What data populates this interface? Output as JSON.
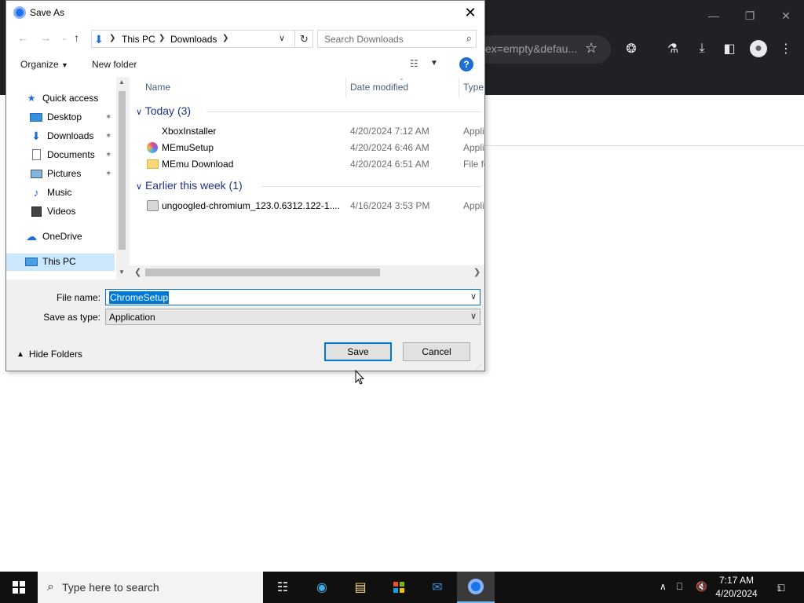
{
  "browser": {
    "url_fragment": "ex=empty&defau..."
  },
  "dialog": {
    "title": "Save As",
    "nav": {
      "breadcrumb": [
        "This PC",
        "Downloads"
      ],
      "search_placeholder": "Search Downloads"
    },
    "toolbar": {
      "organize_label": "Organize",
      "new_folder_label": "New folder",
      "help_label": "?"
    },
    "sidebar": {
      "items": [
        {
          "label": "Quick access",
          "icon": "star-icon"
        },
        {
          "label": "Desktop",
          "icon": "desktop-icon",
          "pinned": true
        },
        {
          "label": "Downloads",
          "icon": "download-arrow-icon",
          "pinned": true
        },
        {
          "label": "Documents",
          "icon": "documents-icon",
          "pinned": true
        },
        {
          "label": "Pictures",
          "icon": "pictures-icon",
          "pinned": true
        },
        {
          "label": "Music",
          "icon": "music-icon"
        },
        {
          "label": "Videos",
          "icon": "videos-icon"
        },
        {
          "label": "OneDrive",
          "icon": "cloud-icon"
        },
        {
          "label": "This PC",
          "icon": "computer-icon",
          "selected": true
        }
      ]
    },
    "columns": [
      "Name",
      "Date modified",
      "Type"
    ],
    "groups": [
      {
        "label": "Today (3)",
        "files": [
          {
            "name": "XboxInstaller",
            "date": "4/20/2024 7:12 AM",
            "type": "Appli",
            "icon": "app-icon"
          },
          {
            "name": "MEmuSetup",
            "date": "4/20/2024 6:46 AM",
            "type": "Appli",
            "icon": "memu-icon"
          },
          {
            "name": "MEmu Download",
            "date": "4/20/2024 6:51 AM",
            "type": "File fo",
            "icon": "folder-icon"
          }
        ]
      },
      {
        "label": "Earlier this week (1)",
        "files": [
          {
            "name": "ungoogled-chromium_123.0.6312.122-1....",
            "date": "4/16/2024 3:53 PM",
            "type": "Appli",
            "icon": "installer-icon"
          }
        ]
      }
    ],
    "form": {
      "file_name_label": "File name:",
      "file_name_value": "ChromeSetup",
      "save_type_label": "Save as type:",
      "save_type_value": "Application"
    },
    "hide_folders_label": "Hide Folders",
    "save_label": "Save",
    "cancel_label": "Cancel"
  },
  "taskbar": {
    "search_placeholder": "Type here to search",
    "time": "7:17 AM",
    "date": "4/20/2024",
    "notification_count": "1"
  },
  "colors": {
    "accent": "#0078d7",
    "chrome_dark": "#202124",
    "selection": "#cce8ff",
    "group_header": "#1e3287"
  }
}
